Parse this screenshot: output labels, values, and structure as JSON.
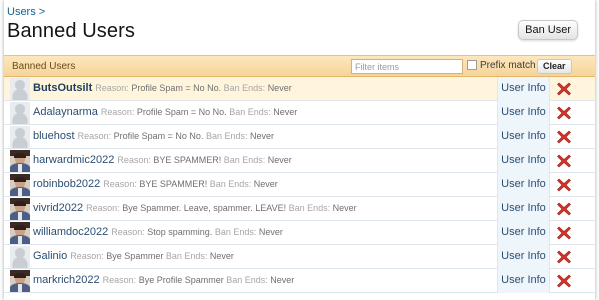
{
  "breadcrumb": {
    "link": "Users",
    "separator": ">"
  },
  "page_title": "Banned Users",
  "ban_button_label": "Ban User",
  "toolbar": {
    "title": "Banned Users",
    "filter_placeholder": "Filter items",
    "prefix_label": "Prefix match",
    "clear_label": "Clear"
  },
  "labels": {
    "reason": "Reason:",
    "ban_ends": "Ban Ends:"
  },
  "rows": [
    {
      "username": "ButsOutsilt",
      "reason": "Profile Spam = No No.",
      "ban_ends": "Never",
      "info": "User Info",
      "avatar": "default-avatar"
    },
    {
      "username": "Adalaynarma",
      "reason": "Profile Spam = No No.",
      "ban_ends": "Never",
      "info": "User Info",
      "avatar": "default-avatar"
    },
    {
      "username": "bluehost",
      "reason": "Profile Spam = No No.",
      "ban_ends": "Never",
      "info": "User Info",
      "avatar": "default-avatar"
    },
    {
      "username": "harwardmic2022",
      "reason": "BYE SPAMMER!",
      "ban_ends": "Never",
      "info": "User Info",
      "avatar": "photo-avatar"
    },
    {
      "username": "robinbob2022",
      "reason": "BYE SPAMMER!",
      "ban_ends": "Never",
      "info": "User Info",
      "avatar": "photo-avatar"
    },
    {
      "username": "vivrid2022",
      "reason": "Bye Spammer. Leave, spammer. LEAVE!",
      "ban_ends": "Never",
      "info": "User Info",
      "avatar": "photo-avatar"
    },
    {
      "username": "williamdoc2022",
      "reason": "Stop spamming.",
      "ban_ends": "Never",
      "info": "User Info",
      "avatar": "photo-avatar"
    },
    {
      "username": "Galinio",
      "reason": "Bye Spammer",
      "ban_ends": "Never",
      "info": "User Info",
      "avatar": "default-avatar"
    },
    {
      "username": "markrich2022",
      "reason": "Bye Profile Spammer",
      "ban_ends": "Never",
      "info": "User Info",
      "avatar": "photo-avatar"
    }
  ],
  "colors": {
    "link": "#2b4e72",
    "toolbar_top": "#fde7bd",
    "toolbar_bottom": "#f6d49a",
    "highlight_row": "#fff4dc",
    "info_cell": "#eef5fb",
    "delete": "#d2362a"
  },
  "icons": {
    "delete": "delete-x-icon",
    "checkbox": "checkbox-icon"
  }
}
